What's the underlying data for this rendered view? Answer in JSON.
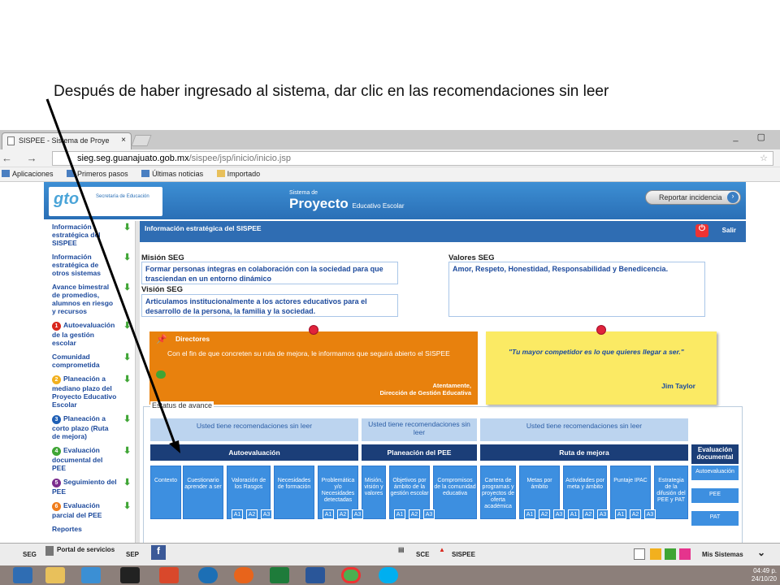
{
  "caption": "Después de haber ingresado al sistema, dar clic en las recomendaciones sin leer",
  "browser": {
    "tab_title": "SISPEE - Sistema de Proye",
    "tab_close": "×",
    "url_host": "sieg.seg.guanajuato.gob.mx",
    "url_path": "/sispee/jsp/inicio/inicio.jsp",
    "nav": "← → C",
    "window_buttons": "_ ▢",
    "bookmarks": [
      "Aplicaciones",
      "Primeros pasos",
      "Últimas noticias",
      "Importado"
    ]
  },
  "banner": {
    "logo": "gto",
    "logo_sub": "Secretaría de Educación",
    "sistema": "Sistema de",
    "proyecto": "Proyecto",
    "proyecto_sub": "Educativo Escolar",
    "report_button": "Reportar incidencia"
  },
  "sidebar": {
    "items": [
      {
        "label": "Información estratégica del SISPEE",
        "num": "",
        "color": ""
      },
      {
        "label": "Información estratégica de otros sistemas",
        "num": "",
        "color": ""
      },
      {
        "label": "Avance bimestral de promedios, alumnos en riesgo y recursos",
        "num": "",
        "color": ""
      },
      {
        "label": "Autoevaluación de la gestión escolar",
        "num": "1",
        "color": "#d9261c"
      },
      {
        "label": "Comunidad comprometida",
        "num": "",
        "color": ""
      },
      {
        "label": "Planeación a mediano plazo del Proyecto Educativo Escolar",
        "num": "2",
        "color": "#f2b01e"
      },
      {
        "label": "Planeación a corto plazo (Ruta de mejora)",
        "num": "3",
        "color": "#1f5fb5"
      },
      {
        "label": "Evaluación documental del PEE",
        "num": "4",
        "color": "#3fa535"
      },
      {
        "label": "Seguimiento del PEE",
        "num": "5",
        "color": "#7b2d8e"
      },
      {
        "label": "Evaluación parcial del PEE",
        "num": "6",
        "color": "#f07c1b"
      },
      {
        "label": "Reportes",
        "num": "",
        "color": ""
      }
    ]
  },
  "main": {
    "header": "Información estratégica del SISPEE",
    "logout": "Salir",
    "mision_label": "Misión SEG",
    "mision": "Formar personas íntegras en colaboración con la sociedad para que trasciendan en un entorno dinámico",
    "vision_label": "Visión SEG",
    "vision": "Articulamos institucionalmente a los actores educativos para el desarrollo de la persona, la familia y la sociedad.",
    "valores_label": "Valores SEG",
    "valores": "Amor, Respeto, Honestidad, Responsabilidad y Benedicencia.",
    "note_title": "Directores",
    "note_msg": "Con el fin de que concreten su ruta de mejora, le informamos que seguirá abierto el SISPEE",
    "note_sig1": "Atentamente,",
    "note_sig2": "Dirección de Gestión Educativa",
    "quote": "\"Tu mayor competidor es lo que quieres llegar a ser.\"",
    "quote_author": "Jim Taylor",
    "estatus_title": "Estatus de avance"
  },
  "status": {
    "rec1": "Usted tiene recomendaciones sin leer",
    "rec2": "Usted tiene recomendaciones sin leer",
    "rec3": "Usted tiene recomendaciones sin leer",
    "sections": [
      "Autoevaluación",
      "Planeación del PEE",
      "Ruta de mejora",
      "Evaluación documental"
    ],
    "cells": [
      "Contexto",
      "Cuestionario aprender a ser",
      "Valoración de los Rasgos",
      "Necesidades de formación",
      "Problemática y/o Necesidades detectadas",
      "Misión, visión y valores",
      "Objetivos por ámbito de la gestión escolar",
      "Compromisos de la comunidad educativa",
      "Cartera de programas y proyectos de oferta académica",
      "Metas por ámbito",
      "Actividades por meta y ámbito",
      "Puntaje IPAC",
      "Estrategia de la difusión del PEE y PAT"
    ],
    "subs": [
      "A1",
      "A2",
      "A3"
    ],
    "eval_items": [
      "Autoevaluación",
      "PEE",
      "PAT"
    ]
  },
  "bottom": {
    "seg": "SEG",
    "portal": "Portal de servicios",
    "sep": "SEP",
    "sce": "SCE",
    "sispee": "SISPEE",
    "mis_sistemas": "Mis Sistemas"
  },
  "taskbar": {
    "time": "04:49 p.",
    "date": "24/10/20"
  }
}
